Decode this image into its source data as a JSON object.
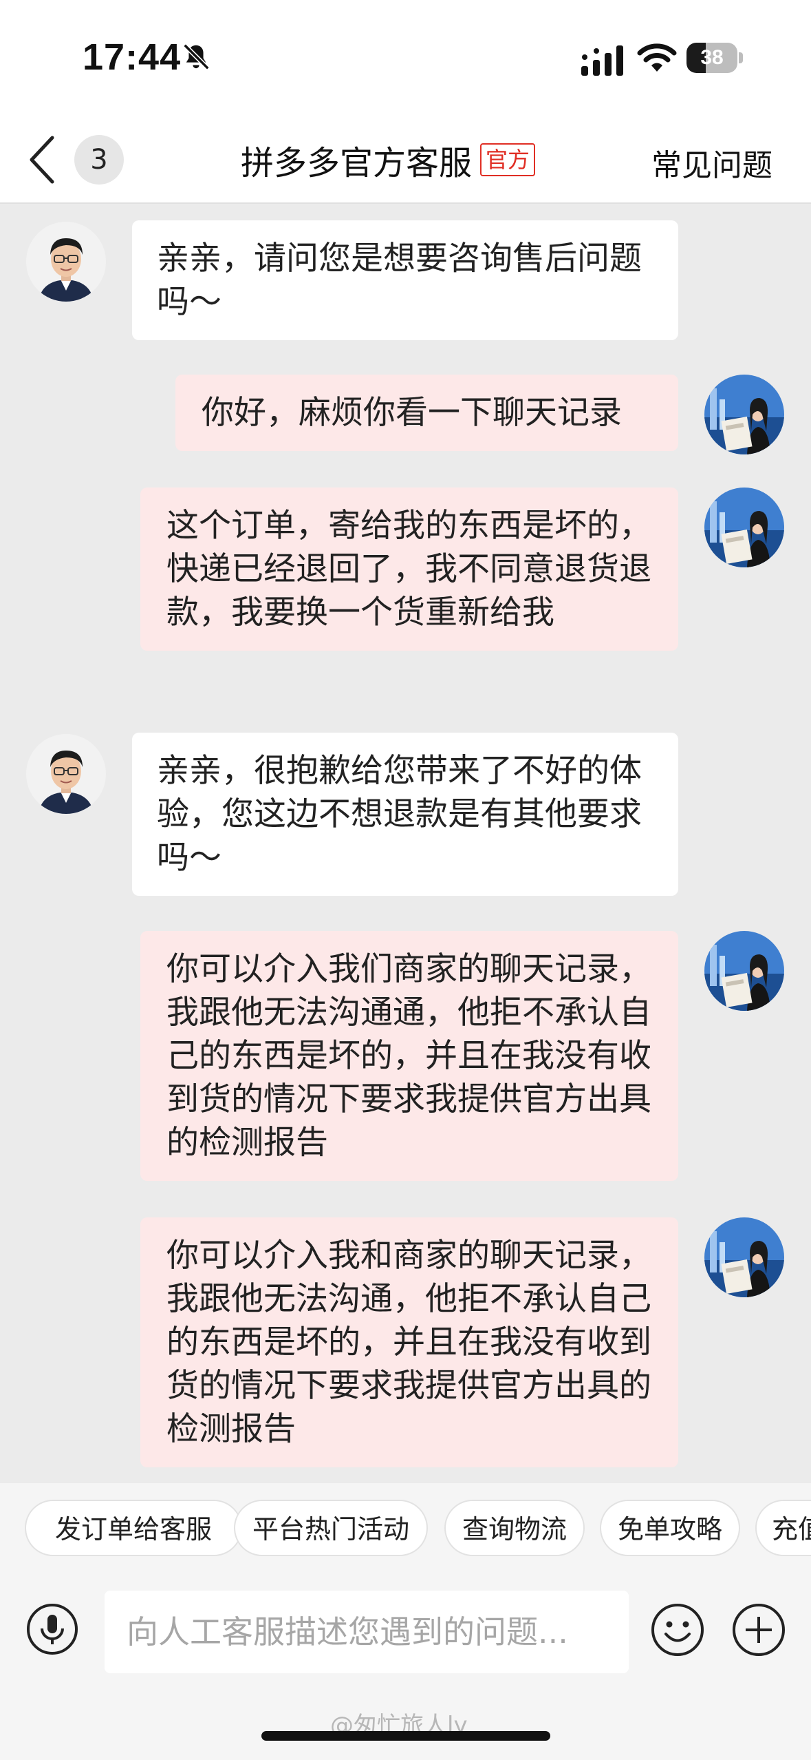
{
  "status_bar": {
    "time": "17:44",
    "battery": "38",
    "battery_level": 0.38
  },
  "nav": {
    "unread_count": "3",
    "title": "拼多多官方客服",
    "tag": "官方",
    "faq": "常见问题"
  },
  "messages": [
    {
      "from": "agent",
      "text": "亲亲，请问您是想要咨询售后问题吗～"
    },
    {
      "from": "user",
      "text": "你好，麻烦你看一下聊天记录"
    },
    {
      "from": "user",
      "text": "这个订单，寄给我的东西是坏的，快递已经退回了，我不同意退货退款，我要换一个货重新给我"
    },
    {
      "from": "agent",
      "text": "亲亲，很抱歉给您带来了不好的体验，您这边不想退款是有其他要求吗～"
    },
    {
      "from": "user",
      "text": "你可以介入我们商家的聊天记录，我跟他无法沟通通，他拒不承认自己的东西是坏的，并且在我没有收到货的情况下要求我提供官方出具的检测报告"
    },
    {
      "from": "user",
      "text": "你可以介入我和商家的聊天记录，我跟他无法沟通，他拒不承认自己的东西是坏的，并且在我没有收到货的情况下要求我提供官方出具的检测报告"
    }
  ],
  "quick_actions": [
    "发订单给客服",
    "平台热门活动",
    "查询物流",
    "免单攻略",
    "充值"
  ],
  "input": {
    "placeholder": "向人工客服描述您遇到的问题..."
  },
  "watermark": "@匆忙旅人ly",
  "icons": {
    "back": "chevron-left-icon",
    "mute": "bell-slash-icon",
    "signal": "cellular-signal-icon",
    "wifi": "wifi-icon",
    "battery": "battery-icon",
    "mic": "microphone-icon",
    "emoji": "smiley-icon",
    "plus": "plus-icon"
  },
  "colors": {
    "accent": "#e02e24",
    "user_bubble": "#fde8e8",
    "agent_bubble": "#ffffff",
    "chat_bg": "#ebebeb"
  }
}
